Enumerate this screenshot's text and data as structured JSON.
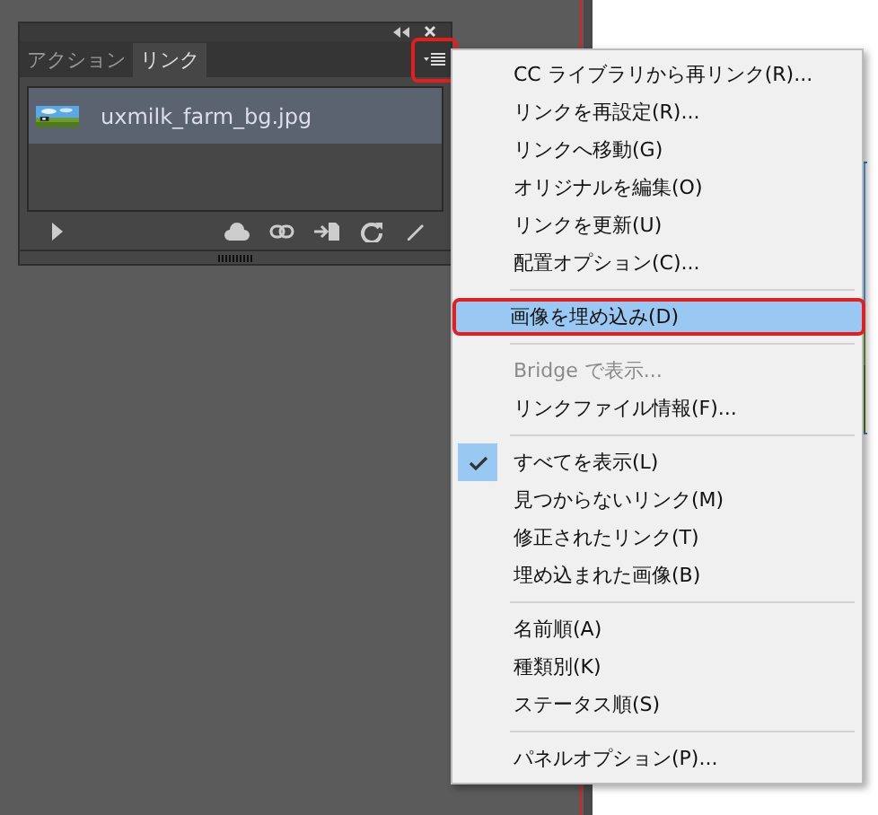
{
  "panel": {
    "tabs": [
      {
        "label": "アクション",
        "selected": false
      },
      {
        "label": "リンク",
        "selected": true
      }
    ],
    "menu_button": {
      "annotated": true
    },
    "links": [
      {
        "name": "uxmilk_farm_bg.jpg",
        "selected": true
      }
    ]
  },
  "menu": {
    "groups": [
      [
        {
          "label": "CC ライブラリから再リンク(R)...",
          "selected": false,
          "disabled": false,
          "checked": false,
          "annotated": false
        },
        {
          "label": "リンクを再設定(R)...",
          "selected": false,
          "disabled": false,
          "checked": false,
          "annotated": false
        },
        {
          "label": "リンクへ移動(G)",
          "selected": false,
          "disabled": false,
          "checked": false,
          "annotated": false
        },
        {
          "label": "オリジナルを編集(O)",
          "selected": false,
          "disabled": false,
          "checked": false,
          "annotated": false
        },
        {
          "label": "リンクを更新(U)",
          "selected": false,
          "disabled": false,
          "checked": false,
          "annotated": false
        },
        {
          "label": "配置オプション(C)...",
          "selected": false,
          "disabled": false,
          "checked": false,
          "annotated": false
        }
      ],
      [
        {
          "label": "画像を埋め込み(D)",
          "selected": true,
          "disabled": false,
          "checked": false,
          "annotated": true
        }
      ],
      [
        {
          "label": "Bridge で表示...",
          "selected": false,
          "disabled": true,
          "checked": false,
          "annotated": false
        },
        {
          "label": "リンクファイル情報(F)...",
          "selected": false,
          "disabled": false,
          "checked": false,
          "annotated": false
        }
      ],
      [
        {
          "label": "すべてを表示(L)",
          "selected": false,
          "disabled": false,
          "checked": true,
          "annotated": false
        },
        {
          "label": "見つからないリンク(M)",
          "selected": false,
          "disabled": false,
          "checked": false,
          "annotated": false
        },
        {
          "label": "修正されたリンク(T)",
          "selected": false,
          "disabled": false,
          "checked": false,
          "annotated": false
        },
        {
          "label": "埋め込まれた画像(B)",
          "selected": false,
          "disabled": false,
          "checked": false,
          "annotated": false
        }
      ],
      [
        {
          "label": "名前順(A)",
          "selected": false,
          "disabled": false,
          "checked": false,
          "annotated": false
        },
        {
          "label": "種類別(K)",
          "selected": false,
          "disabled": false,
          "checked": false,
          "annotated": false
        },
        {
          "label": "ステータス順(S)",
          "selected": false,
          "disabled": false,
          "checked": false,
          "annotated": false
        }
      ],
      [
        {
          "label": "パネルオプション(P)...",
          "selected": false,
          "disabled": false,
          "checked": false,
          "annotated": false
        }
      ]
    ]
  }
}
